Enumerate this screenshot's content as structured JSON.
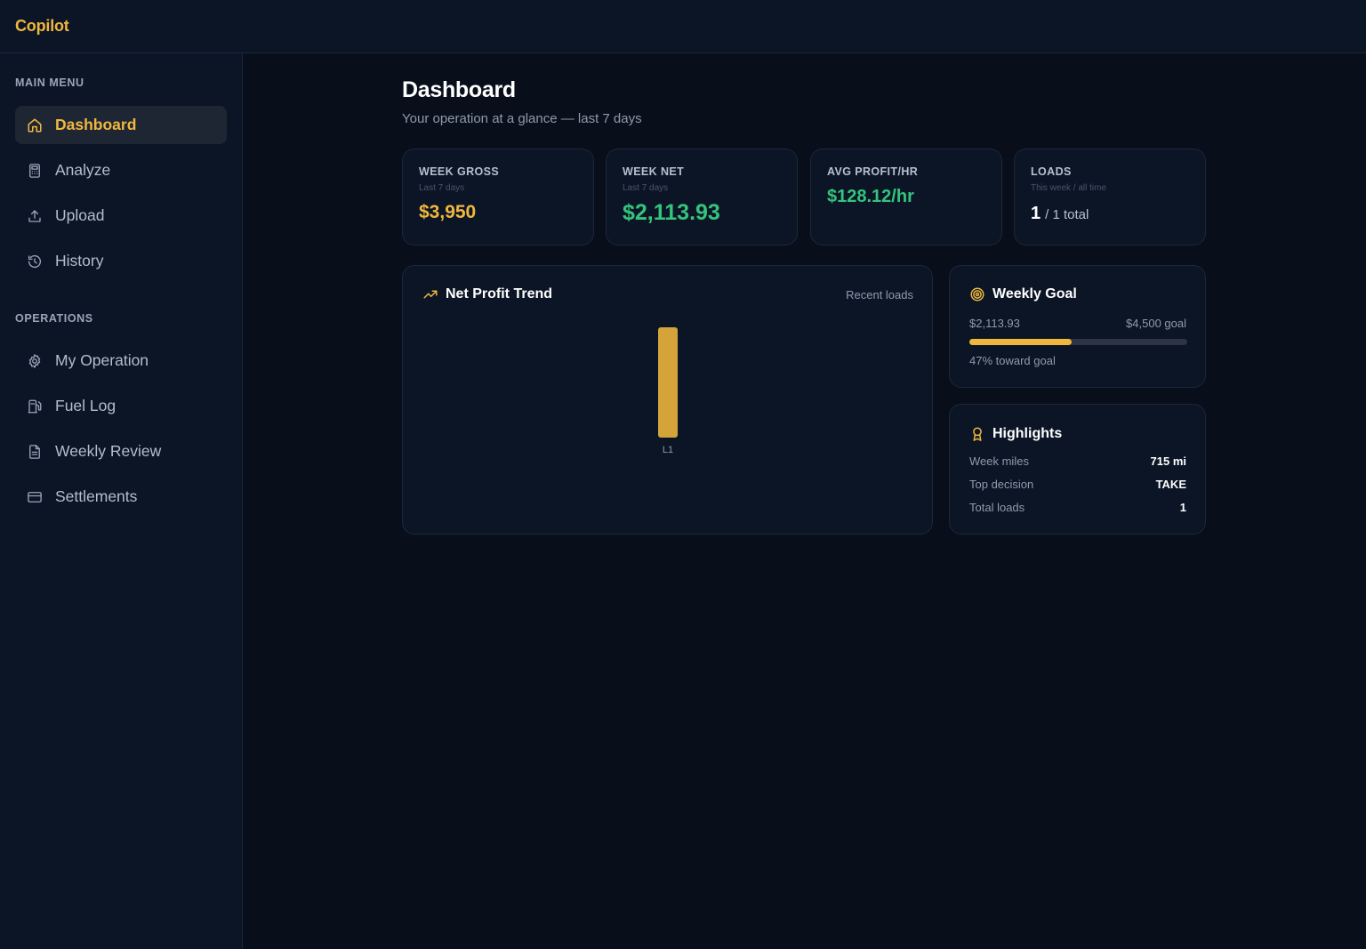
{
  "app": {
    "name": "Copilot"
  },
  "sidebar": {
    "main_menu_label": "MAIN MENU",
    "operations_label": "OPERATIONS",
    "items": [
      {
        "label": "Dashboard",
        "icon": "home-icon",
        "active": true
      },
      {
        "label": "Analyze",
        "icon": "calculator-icon"
      },
      {
        "label": "Upload",
        "icon": "upload-icon"
      },
      {
        "label": "History",
        "icon": "history-icon"
      },
      {
        "label": "My Operation",
        "icon": "gear-icon"
      },
      {
        "label": "Fuel Log",
        "icon": "fuel-icon"
      },
      {
        "label": "Weekly Review",
        "icon": "document-icon"
      },
      {
        "label": "Settlements",
        "icon": "card-icon"
      }
    ]
  },
  "header": {
    "title": "Dashboard",
    "subtitle": "Your operation at a glance — last 7 days"
  },
  "stats": [
    {
      "label": "WEEK GROSS",
      "sub": "Last 7 days",
      "value": "$3,950",
      "color": "#f0b73d"
    },
    {
      "label": "WEEK NET",
      "sub": "Last 7 days",
      "value": "$2,113.93",
      "color": "#34c47c"
    },
    {
      "label": "AVG PROFIT/HR",
      "value": "$128.12/hr",
      "color": "#34c47c"
    },
    {
      "label": "LOADS",
      "sub": "This week / all time",
      "value_main": "1",
      "value_rest": "/ 1 total",
      "color": "#ffffff"
    }
  ],
  "trend": {
    "title": "Net Profit Trend",
    "right_label": "Recent loads",
    "icon": "trending-up-icon"
  },
  "chart_data": {
    "type": "bar",
    "categories": [
      "L1"
    ],
    "values": [
      2113.93
    ],
    "title": "Net Profit Trend",
    "color": "#d4a43a"
  },
  "goal": {
    "title": "Weekly Goal",
    "icon": "target-icon",
    "current": "$2,113.93",
    "target": "$4,500 goal",
    "progress_pct": 47,
    "progress_text": "47% toward goal"
  },
  "highlights": {
    "title": "Highlights",
    "icon": "award-icon",
    "rows": [
      {
        "label": "Week miles",
        "value": "715 mi"
      },
      {
        "label": "Top decision",
        "value": "TAKE"
      },
      {
        "label": "Total loads",
        "value": "1"
      }
    ]
  },
  "colors": {
    "accent": "#f0b73d",
    "positive": "#34c47c",
    "bg": "#080f1b",
    "panel": "#0c1526"
  }
}
